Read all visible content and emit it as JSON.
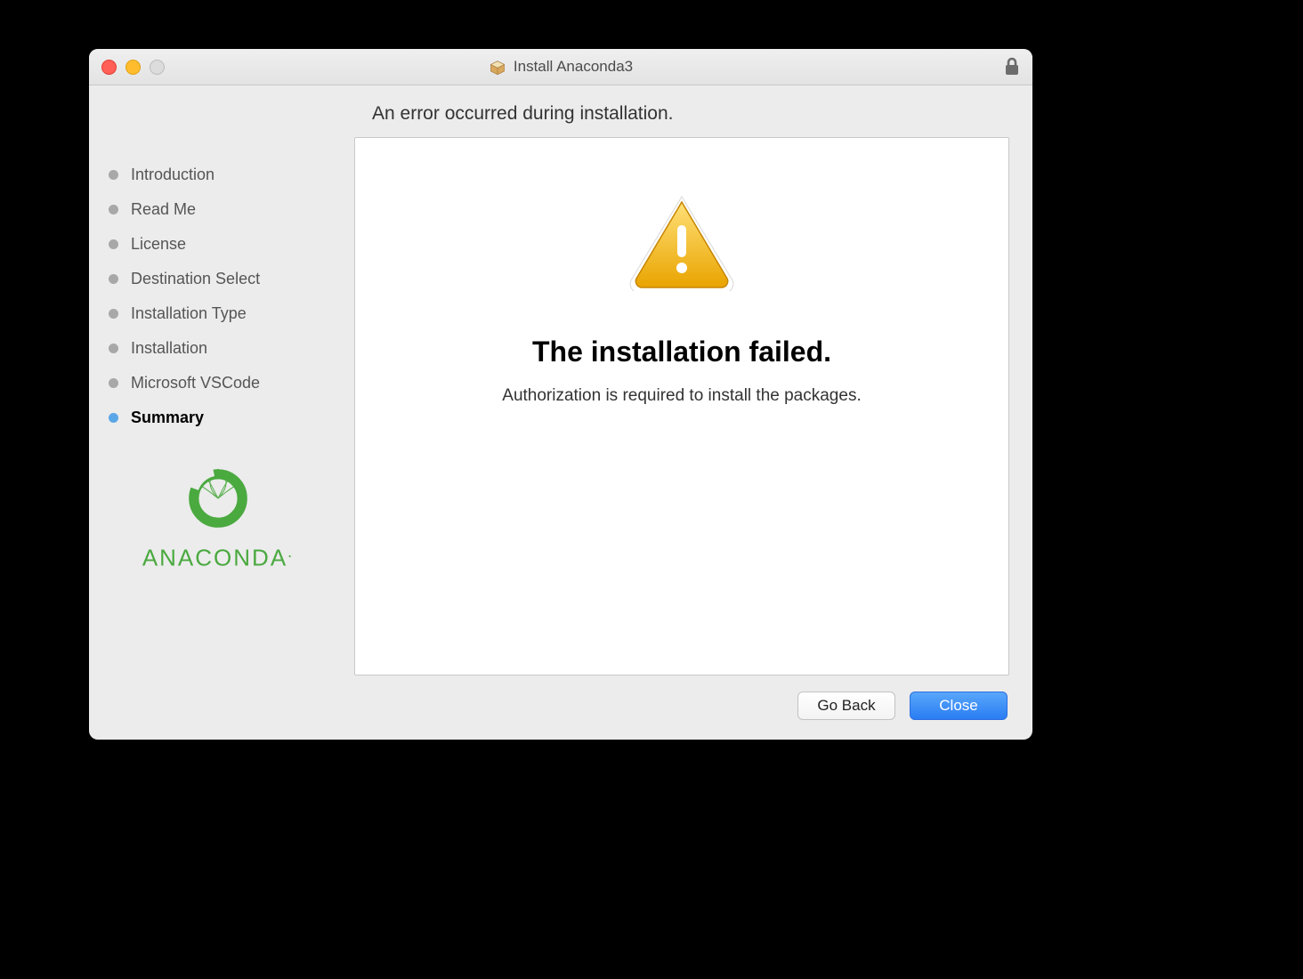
{
  "window": {
    "title": "Install Anaconda3"
  },
  "heading": "An error occurred during installation.",
  "sidebar": {
    "steps": [
      {
        "label": "Introduction",
        "active": false
      },
      {
        "label": "Read Me",
        "active": false
      },
      {
        "label": "License",
        "active": false
      },
      {
        "label": "Destination Select",
        "active": false
      },
      {
        "label": "Installation Type",
        "active": false
      },
      {
        "label": "Installation",
        "active": false
      },
      {
        "label": "Microsoft VSCode",
        "active": false
      },
      {
        "label": "Summary",
        "active": true
      }
    ],
    "brand": "ANACONDA"
  },
  "content": {
    "title": "The installation failed.",
    "message": "Authorization is required to install the packages."
  },
  "footer": {
    "go_back": "Go Back",
    "close": "Close"
  }
}
